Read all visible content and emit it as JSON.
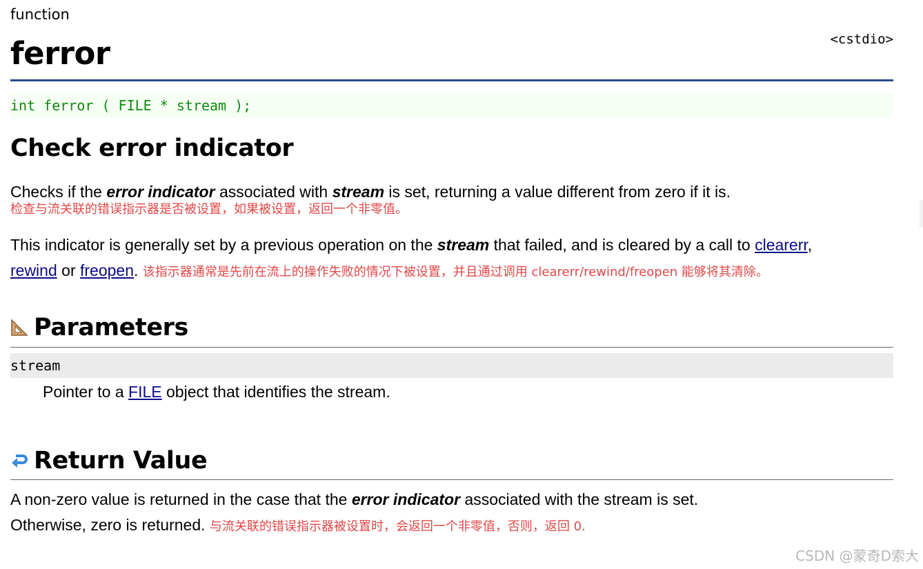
{
  "header": {
    "kind": "function",
    "title": "ferror",
    "library": "<cstdio>"
  },
  "prototype": "int ferror ( FILE * stream );",
  "section_description": {
    "heading": "Check error indicator",
    "p1_pre": "Checks if the ",
    "p1_bold1": "error indicator",
    "p1_mid": " associated with ",
    "p1_bold2": "stream",
    "p1_post": " is set, returning a value different from zero if it is.",
    "p1_note_cn": "检查与流关联的错误指示器是否被设置，如果被设置，返回一个非零值。",
    "p2_pre": "This indicator is generally set by a previous operation on the ",
    "p2_bold": "stream",
    "p2_mid": " that failed, and is cleared by a call to ",
    "link_clearerr": "clearerr",
    "p2_comma": ",",
    "link_rewind": "rewind",
    "p2_or": " or ",
    "link_freopen": "freopen",
    "p2_end": ".",
    "p2_note_cn": "该指示器通常是先前在流上的操作失败的情况下被设置，并且通过调用 clearerr/rewind/freopen 能够将其清除。"
  },
  "section_parameters": {
    "heading": "Parameters",
    "icon": "triangle-ruler-icon",
    "param_name": "stream",
    "desc_pre": "Pointer to a ",
    "desc_link": "FILE",
    "desc_post": " object that identifies the stream."
  },
  "section_return": {
    "heading": "Return Value",
    "icon": "return-arrow-icon",
    "line1_pre": "A non-zero value is returned in the case that the ",
    "line1_bold": "error indicator",
    "line1_post": " associated with the stream is set.",
    "line2": "Otherwise, zero is returned.",
    "line2_note_cn": "与流关联的错误指示器被设置时，会返回一个非零值，否则，返回 0."
  },
  "watermark": "CSDN @蒙奇D索大",
  "colors": {
    "title_rule": "#2a4a8a",
    "prototype_text": "#118811",
    "note_cn": "#e04848",
    "link": "#0a0a88"
  }
}
